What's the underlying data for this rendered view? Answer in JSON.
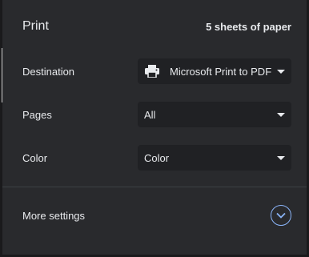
{
  "header": {
    "title": "Print",
    "sheets": "5 sheets of paper"
  },
  "destination": {
    "label": "Destination",
    "value": "Microsoft Print to PDF",
    "icon": "printer-icon"
  },
  "pages": {
    "label": "Pages",
    "value": "All"
  },
  "color": {
    "label": "Color",
    "value": "Color"
  },
  "more_settings": {
    "label": "More settings",
    "icon": "chevron-down-icon"
  },
  "colors": {
    "background": "#292a2d",
    "select_background": "#202124",
    "text": "#e8eaed",
    "accent": "#8ab4f8",
    "divider": "#3c4043"
  }
}
